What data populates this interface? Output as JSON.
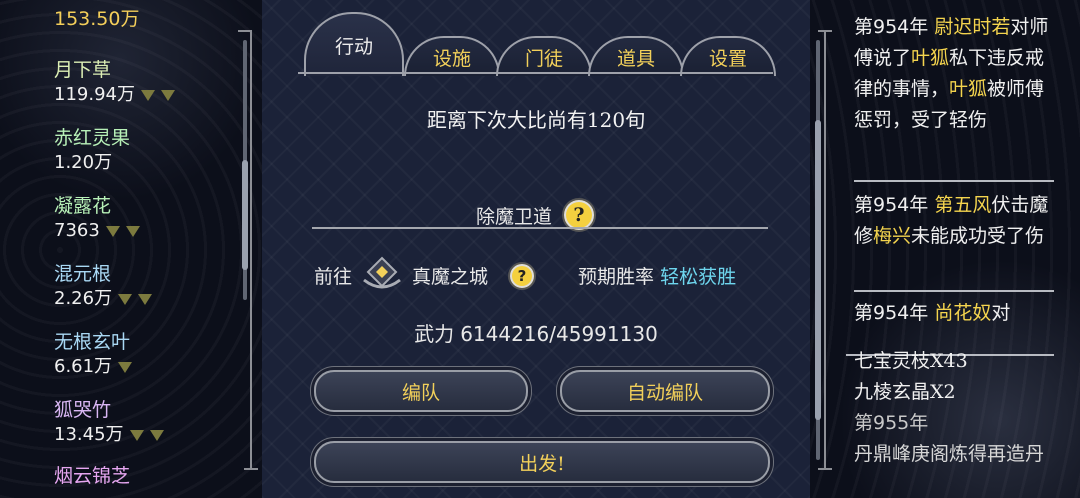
{
  "left": {
    "currency": "153.50万",
    "herbs": [
      {
        "name": "月下草",
        "amount": "119.94万",
        "color": "#dcefb4"
      },
      {
        "name": "赤红灵果",
        "amount": "1.20万",
        "color": "#b7f0b7"
      },
      {
        "name": "凝露花",
        "amount": "7363",
        "color": "#b7f0b7"
      },
      {
        "name": "混元根",
        "amount": "2.26万",
        "color": "#a9d8f4"
      },
      {
        "name": "无根玄叶",
        "amount": "6.61万",
        "color": "#a9d8f4"
      },
      {
        "name": "狐哭竹",
        "amount": "13.45万",
        "color": "#d9b7f4"
      },
      {
        "name": "烟云锦芝",
        "amount": "",
        "color": "#e6a6f0"
      }
    ]
  },
  "tabs": [
    "行动",
    "设施",
    "门徒",
    "道具",
    "设置"
  ],
  "center": {
    "countdown": "距离下次大比尚有120旬",
    "section_title": "除魔卫道",
    "goto_label": "前往",
    "destination": "真魔之城",
    "expect_label": "预期胜率",
    "expect_value": "轻松获胜",
    "power_label": "武力",
    "power_value": "6144216/45991130",
    "btn_team": "编队",
    "btn_auto_team": "自动编队",
    "btn_depart": "出发!"
  },
  "right": {
    "entry1": {
      "year": "第954年",
      "name1": "尉迟时若",
      "t1": "对师傅说了",
      "name2": "叶狐",
      "t2": "私下违反戒律的事情，",
      "name3": "叶狐",
      "t3": "被师傅惩罚，受了轻伤"
    },
    "entry2": {
      "year": "第954年",
      "name1": "第五风",
      "t1": "伏击魔修",
      "name2": "梅兴",
      "t2": "未能成功受了伤"
    },
    "entry3": {
      "year": "第954年",
      "name1": "尚花奴",
      "t1": "对"
    },
    "entry4": {
      "line1": "七宝灵枝X43",
      "line2": "九棱玄晶X2",
      "year": "第955年",
      "t1": "丹鼎峰庚阁炼得再造丹"
    }
  }
}
